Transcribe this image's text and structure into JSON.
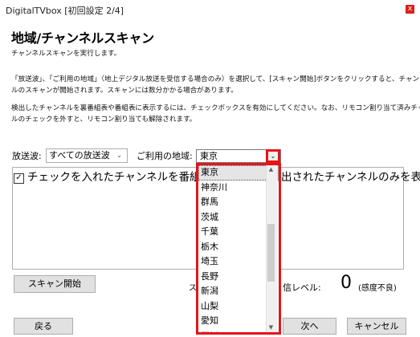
{
  "window": {
    "title": "DigitalTVbox [初回設定 2/4]",
    "close_glyph": "x"
  },
  "page": {
    "heading": "地域/チャンネルスキャン",
    "intro": "チャンネルスキャンを実行します。",
    "para1_line1": "「放送波」、「ご利用の地域」（地上デジタル放送を受信する場合のみ）を選択して、[スキャン開始]ボタンをクリックすると、チャンネ",
    "para1_line2": "ルのスキャンが開始されます。スキャンには数分かかる場合があります。",
    "para2_line1": "検出したチャンネルを裏番組表や番組表に表示するには、チェックボックスを有効にしてください。なお、リモコン割り当て済みチャンネ",
    "para2_line2": "ルのチェックを外すと、リモコン割り当ても解除されます。"
  },
  "controls": {
    "broadcast_label": "放送波:",
    "broadcast_value": "すべての放送波",
    "region_label": "ご利用の地域:",
    "region_value": "東京",
    "checkbox_label_left": "チェックを入れたチャンネルを番組表に表",
    "checkbox_label_right": "出されたチャンネルのみを表示",
    "checkbox_mark": "✓",
    "scan_button": "スキャン開始",
    "signal_label": "信レベル:",
    "signal_value": "0",
    "signal_status": "(感度不良)",
    "partial_char": "ス"
  },
  "dropdown": {
    "selected_index": 0,
    "options": [
      "東京",
      "神奈川",
      "群馬",
      "茨城",
      "千葉",
      "栃木",
      "埼玉",
      "長野",
      "新潟",
      "山梨",
      "愛知",
      "石川"
    ]
  },
  "footer": {
    "back_button": "戻る",
    "next_button": "次へ",
    "cancel_button": "キャンセル"
  },
  "icons": {
    "dropdown_arrow": "chevron-down-icon",
    "checkbox": "checkmark-icon",
    "close": "close-icon"
  },
  "colors": {
    "highlight_red": "#e5141b",
    "close_red": "#d9221c"
  }
}
